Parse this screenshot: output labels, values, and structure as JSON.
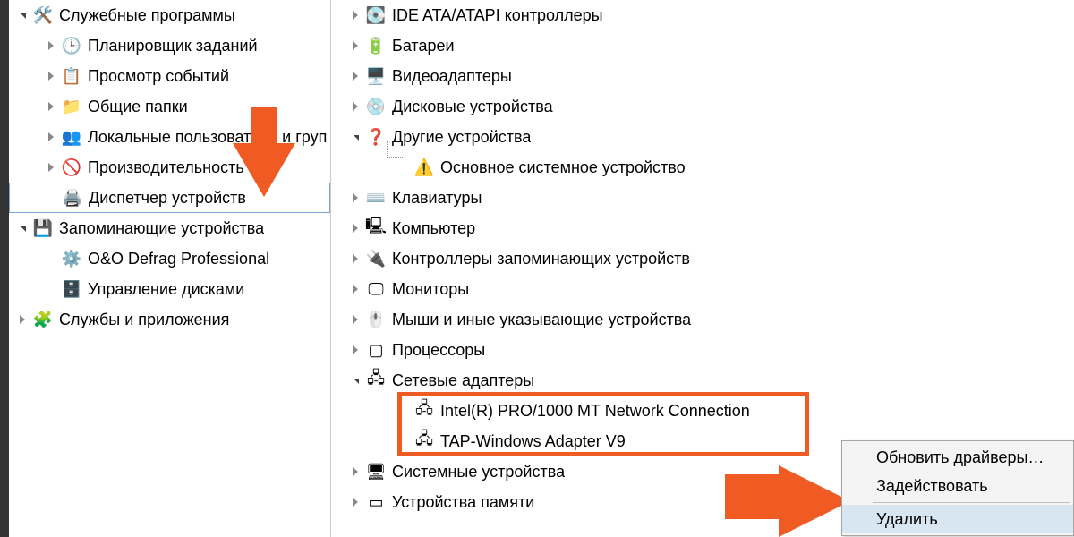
{
  "left": {
    "utilities": {
      "label": "Служебные программы",
      "items": [
        {
          "icon": "clock-icon",
          "label": "Планировщик заданий"
        },
        {
          "icon": "eventlog-icon",
          "label": "Просмотр событий"
        },
        {
          "icon": "folders-icon",
          "label": "Общие папки"
        },
        {
          "icon": "users-icon",
          "label": "Локальные пользователи и группы"
        },
        {
          "icon": "perf-icon",
          "label": "Производительность"
        },
        {
          "icon": "devmgr-icon",
          "label": "Диспетчер устройств"
        }
      ]
    },
    "storage": {
      "label": "Запоминающие устройства",
      "items": [
        {
          "icon": "defrag-icon",
          "label": "O&O Defrag Professional"
        },
        {
          "icon": "disk-icon",
          "label": "Управление дисками"
        }
      ]
    },
    "services": {
      "label": "Службы и приложения",
      "icon": "services-icon"
    }
  },
  "right": {
    "items": [
      {
        "icon": "ide-icon",
        "label": "IDE ATA/ATAPI контроллеры",
        "exp": "closed"
      },
      {
        "icon": "battery-icon",
        "label": "Батареи",
        "exp": "closed"
      },
      {
        "icon": "display-icon",
        "label": "Видеоадаптеры",
        "exp": "closed"
      },
      {
        "icon": "drive-icon",
        "label": "Дисковые устройства",
        "exp": "closed"
      },
      {
        "icon": "other-icon",
        "label": "Другие устройства",
        "exp": "open",
        "child": {
          "icon": "warn-icon",
          "label": "Основное системное устройство"
        }
      },
      {
        "icon": "keyboard-icon",
        "label": "Клавиатуры",
        "exp": "closed"
      },
      {
        "icon": "computer-icon",
        "label": "Компьютер",
        "exp": "closed"
      },
      {
        "icon": "controller-icon",
        "label": "Контроллеры запоминающих устройств",
        "exp": "closed"
      },
      {
        "icon": "monitor-icon",
        "label": "Мониторы",
        "exp": "closed"
      },
      {
        "icon": "mouse-icon",
        "label": "Мыши и иные указывающие устройства",
        "exp": "closed"
      },
      {
        "icon": "cpu-icon",
        "label": "Процессоры",
        "exp": "closed"
      },
      {
        "icon": "net-icon",
        "label": "Сетевые адаптеры",
        "exp": "open",
        "children": [
          {
            "icon": "nic-icon",
            "label": "Intel(R) PRO/1000 MT Network Connection"
          },
          {
            "icon": "nic-icon",
            "label": "TAP-Windows Adapter V9",
            "highlighted": true
          }
        ]
      },
      {
        "icon": "system-icon",
        "label": "Системные устройства",
        "exp": "closed"
      },
      {
        "icon": "memory-icon",
        "label": "Устройства памяти",
        "exp": "closed"
      }
    ]
  },
  "context_menu": {
    "items": [
      "Обновить драйверы…",
      "Задействовать",
      "Удалить"
    ]
  },
  "annotations": {
    "arrow_color": "#f05a23"
  }
}
